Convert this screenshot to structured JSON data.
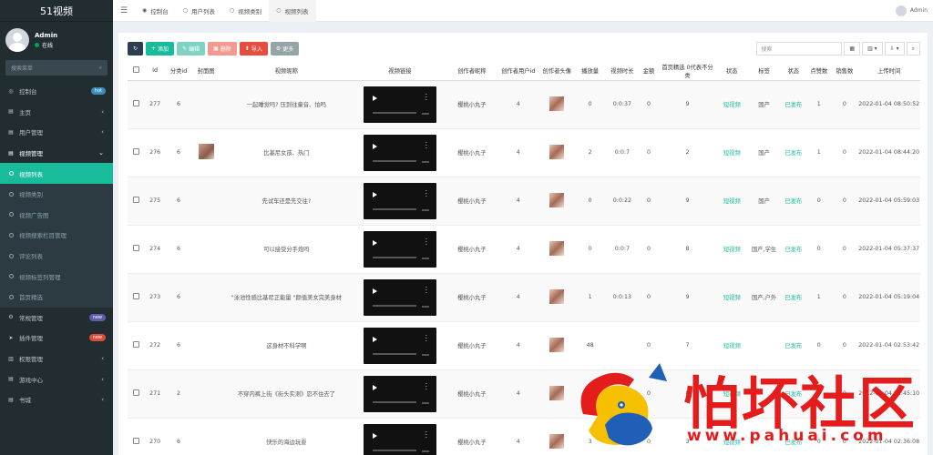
{
  "app": {
    "title": "51视频"
  },
  "user": {
    "name": "Admin",
    "status": "在线"
  },
  "sidebar": {
    "search_placeholder": "搜索菜单",
    "items": [
      {
        "label": "控制台",
        "icon": "dashboard-icon",
        "badge": "hot",
        "badge_color": "#3c8dbc"
      },
      {
        "label": "主页",
        "icon": "home-icon",
        "arrow": "‹"
      },
      {
        "label": "用户管理",
        "icon": "users-icon",
        "arrow": "‹"
      },
      {
        "label": "视频管理",
        "icon": "video-icon",
        "arrow": "⌄"
      },
      {
        "label": "视频列表",
        "sub": true,
        "active": true
      },
      {
        "label": "视频类别",
        "sub": true
      },
      {
        "label": "视频广告图",
        "sub": true
      },
      {
        "label": "视频搜索栏目管理",
        "sub": true
      },
      {
        "label": "评论列表",
        "sub": true
      },
      {
        "label": "视频标签列管理",
        "sub": true
      },
      {
        "label": "首页精选",
        "sub": true
      },
      {
        "label": "常规管理",
        "icon": "cogs-icon",
        "badge": "new",
        "badge_color": "#605ca8"
      },
      {
        "label": "插件管理",
        "icon": "rocket-icon",
        "badge": "new",
        "badge_color": "#dd4b39"
      },
      {
        "label": "权限管理",
        "icon": "group-icon",
        "arrow": "‹"
      },
      {
        "label": "游戏中心",
        "icon": "list-icon",
        "arrow": "‹"
      },
      {
        "label": "书城",
        "icon": "book-icon",
        "arrow": "‹"
      }
    ]
  },
  "topbar": {
    "tabs": [
      {
        "label": "控制台",
        "icon": "dashboard-icon"
      },
      {
        "label": "用户列表",
        "icon": "circle-icon"
      },
      {
        "label": "视频类别",
        "icon": "circle-icon"
      },
      {
        "label": "视频列表",
        "icon": "circle-icon",
        "active": true
      }
    ],
    "user": "Admin"
  },
  "toolbar": {
    "add": "添加",
    "edit": "编辑",
    "delete": "删除",
    "import": "导入",
    "more": "更多",
    "search_placeholder": "搜索"
  },
  "table": {
    "headers": [
      "",
      "Id",
      "分类id",
      "封面图",
      "视频昵称",
      "视频链接",
      "创作者昵称",
      "创作者用户id",
      "创作者头像",
      "播放量",
      "视频时长",
      "金额",
      "首页精选 0代表不分类",
      "状态",
      "标签",
      "状态",
      "点赞数",
      "销售数",
      "上传时间"
    ],
    "rows": [
      {
        "id": "277",
        "cat": "6",
        "cover": false,
        "name": "一起睡觉吗? 压到往童音、怕吗",
        "creator": "樱桃小丸子",
        "uid": "4",
        "views": "0",
        "duration": "0:0:37",
        "amount": "0",
        "pick": "9",
        "type": "短视频",
        "tag": "国产",
        "status": "已发布",
        "likes": "1",
        "sales": "0",
        "time": "2022-01-04 08:50:52"
      },
      {
        "id": "276",
        "cat": "6",
        "cover": true,
        "name": "比基尼女孩、热门",
        "creator": "樱桃小丸子",
        "uid": "4",
        "views": "2",
        "duration": "0:0:7",
        "amount": "0",
        "pick": "2",
        "type": "短视频",
        "tag": "国产",
        "status": "已发布",
        "likes": "1",
        "sales": "0",
        "time": "2022-01-04 08:44:20"
      },
      {
        "id": "275",
        "cat": "6",
        "cover": false,
        "name": "先试车还是先交往?",
        "creator": "樱桃小丸子",
        "uid": "4",
        "views": "0",
        "duration": "0:0:22",
        "amount": "0",
        "pick": "9",
        "type": "短视频",
        "tag": "国产",
        "status": "已发布",
        "likes": "0",
        "sales": "0",
        "time": "2022-01-04 05:59:03"
      },
      {
        "id": "274",
        "cat": "6",
        "cover": false,
        "name": "可以接受分手炮吗",
        "creator": "樱桃小丸子",
        "uid": "4",
        "views": "0",
        "duration": "0:0:7",
        "amount": "0",
        "pick": "8",
        "type": "短视频",
        "tag": "国产,学生",
        "status": "已发布",
        "likes": "0",
        "sales": "0",
        "time": "2022-01-04 05:37:37"
      },
      {
        "id": "273",
        "cat": "6",
        "cover": false,
        "name": "\"泳池性感比基尼正能量 \"颜值美女完美身材",
        "creator": "樱桃小丸子",
        "uid": "4",
        "views": "1",
        "duration": "0:0:13",
        "amount": "0",
        "pick": "9",
        "type": "短视频",
        "tag": "国产,户外",
        "status": "已发布",
        "likes": "1",
        "sales": "0",
        "time": "2022-01-04 05:19:04"
      },
      {
        "id": "272",
        "cat": "6",
        "cover": false,
        "name": "这身材不科学啊",
        "creator": "樱桃小丸子",
        "uid": "4",
        "views": "48",
        "duration": "",
        "amount": "0",
        "pick": "7",
        "type": "短视频",
        "tag": "",
        "status": "已发布",
        "likes": "0",
        "sales": "0",
        "time": "2022-01-04 02:53:42"
      },
      {
        "id": "271",
        "cat": "2",
        "cover": false,
        "name": "不穿内裤上街《街头实测》忍不住去了",
        "creator": "樱桃小丸子",
        "uid": "4",
        "views": "1230",
        "duration": "",
        "amount": "0",
        "pick": "8",
        "type": "短视频",
        "tag": "",
        "status": "已发布",
        "likes": "0",
        "sales": "0",
        "time": "2022-01-04 02:45:10"
      },
      {
        "id": "270",
        "cat": "6",
        "cover": false,
        "name": "快乐的海边玩耍",
        "creator": "樱桃小丸子",
        "uid": "4",
        "views": "3",
        "duration": "",
        "amount": "0",
        "pick": "3",
        "type": "短视频",
        "tag": "",
        "status": "已发布",
        "likes": "0",
        "sales": "0",
        "time": "2022-01-04 02:36:08"
      }
    ]
  },
  "watermark": {
    "text": "怕坏社区",
    "url": "www.pahuai.com"
  }
}
